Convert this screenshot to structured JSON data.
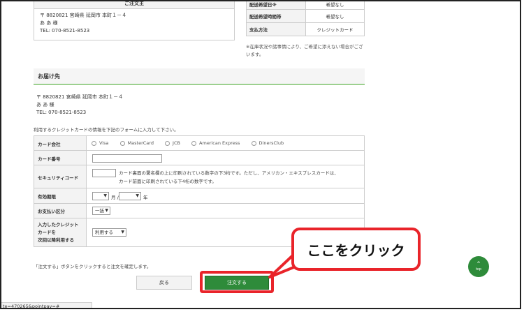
{
  "orderer": {
    "header": "ご注文主",
    "postal": "〒 8820821 宮崎県 延岡市 本町１－４",
    "name": "あ あ 様",
    "tel": "TEL: 070-8521-8523"
  },
  "delivery_info": {
    "rows": [
      {
        "label": "配送希望日※",
        "value": "希望なし"
      },
      {
        "label": "配送希望時間帯",
        "value": "希望なし"
      },
      {
        "label": "支払方法",
        "value": "クレジットカード"
      }
    ],
    "note": "※在庫状況や諸事情により、ご希望に添えない場合がございます。"
  },
  "shipping": {
    "title": "お届け先",
    "postal": "〒 8820821 宮崎県 延岡市 本町１－４",
    "name": "あ あ 様",
    "tel": "TEL: 070-8521-8523"
  },
  "card_form": {
    "intro": "利用するクレジットカードの情報を下記のフォームに入力して下さい。",
    "company_label": "カード会社",
    "companies": [
      "Visa",
      "MasterCard",
      "JCB",
      "American Express",
      "DinersClub"
    ],
    "number_label": "カード番号",
    "security_label": "セキュリティコード",
    "security_help_1": "カード裏面の署名欄の上に印刷されている数字の下3桁です。ただし、アメリカン・エキスプレスカードは、",
    "security_help_2": "カード前面に印刷されている下4桁の数字です。",
    "expiry_label": "有効期限",
    "month_unit": "月 /",
    "year_unit": "年",
    "installment_label": "お支払い区分",
    "installment_value": "一括",
    "save_label_1": "入力したクレジット",
    "save_label_2": "カードを",
    "save_label_3": "次回以降利用する",
    "save_value": "利用する"
  },
  "confirm_text": "「注文する」ボタンをクリックすると注文を確定します。",
  "buttons": {
    "back": "戻る",
    "order": "注文する"
  },
  "callout": "ここをクリック",
  "top_button": "top",
  "status_url": "te=470265&pointpay=#",
  "colors": {
    "accent_green": "#2e8b3a",
    "highlight_red": "#e9242a"
  }
}
